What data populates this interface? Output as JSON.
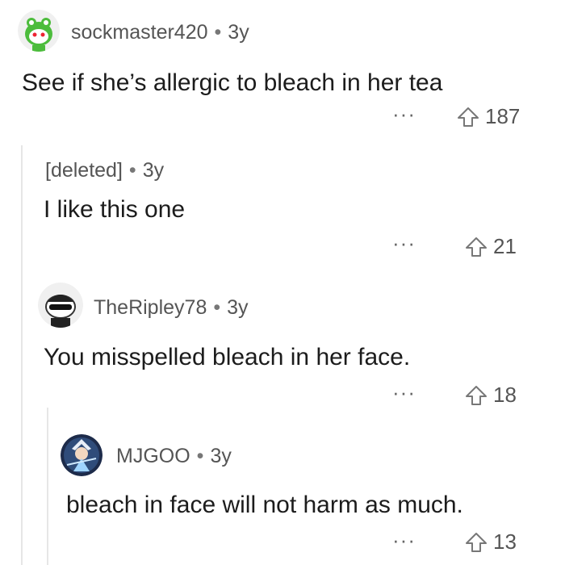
{
  "comments": [
    {
      "username": "sockmaster420",
      "age": "3y",
      "body": "See if she’s allergic to bleach in her tea",
      "votes": "187"
    },
    {
      "username": "[deleted]",
      "age": "3y",
      "body": "I like this one",
      "votes": "21"
    },
    {
      "username": "TheRipley78",
      "age": "3y",
      "body": "You misspelled bleach in her face.",
      "votes": "18"
    },
    {
      "username": "MJGOO",
      "age": "3y",
      "body": "bleach in face will not harm as much.",
      "votes": "13"
    }
  ],
  "separator": "•",
  "more_glyph": "···",
  "icons": {
    "avatar_1": "snoo-avatar-green-frog-hat",
    "avatar_3": "snoo-avatar-sunglasses",
    "avatar_4": "anime-character-avatar",
    "upvote": "upvote-arrow-icon",
    "more": "more-options-icon"
  },
  "colors": {
    "username": "#555555",
    "body": "#1c1c1c",
    "thread_line": "#e6e6e6",
    "avatar_green": "#3fbf3f"
  }
}
